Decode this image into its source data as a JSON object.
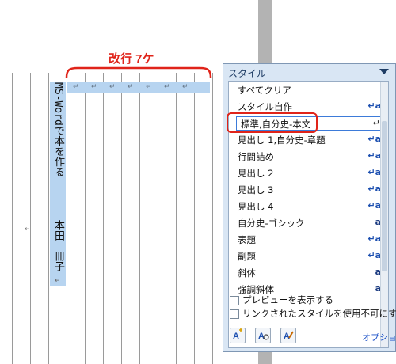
{
  "annotation": {
    "label": "改行 7ケ"
  },
  "document": {
    "vertical_title": "MS-Wordで本を作る",
    "vertical_author": "本田　冊子",
    "return_mark": "↵"
  },
  "styles_panel": {
    "title": "スタイル",
    "items": [
      {
        "label": "すべてクリア",
        "icon": ""
      },
      {
        "label": "スタイル自作",
        "icon": "↵a"
      },
      {
        "label": "標準,自分史-本文",
        "icon": "↵"
      },
      {
        "label": "見出し 1,自分史-章題",
        "icon": "↵a"
      },
      {
        "label": "行間詰め",
        "icon": "↵a"
      },
      {
        "label": "見出し 2",
        "icon": "↵a"
      },
      {
        "label": "見出し 3",
        "icon": "↵a"
      },
      {
        "label": "見出し 4",
        "icon": "↵a"
      },
      {
        "label": "自分史-ゴシック",
        "icon": "a"
      },
      {
        "label": "表題",
        "icon": "↵a"
      },
      {
        "label": "副題",
        "icon": "↵a"
      },
      {
        "label": "斜体",
        "icon": "a"
      },
      {
        "label": "強調斜体",
        "icon": "a"
      }
    ],
    "show_preview": "プレビューを表示する",
    "disable_linked": "リンクされたスタイルを使用不可にする",
    "options_link": "オプション"
  }
}
